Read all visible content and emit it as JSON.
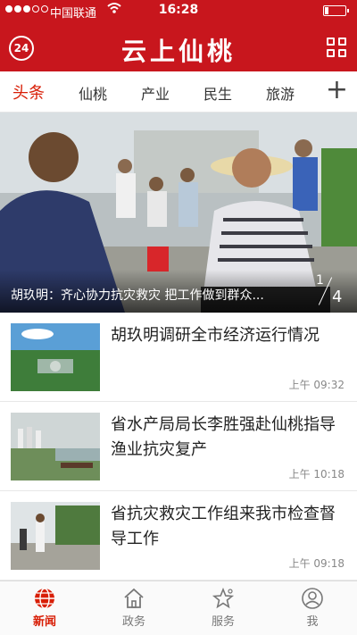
{
  "status_bar": {
    "carrier": "中国联通",
    "time": "16:28",
    "battery_level": 0.2
  },
  "header": {
    "title": "云上仙桃",
    "weather_temp": "24"
  },
  "tabs": [
    {
      "label": "头条",
      "active": true
    },
    {
      "label": "仙桃",
      "active": false
    },
    {
      "label": "产业",
      "active": false
    },
    {
      "label": "民生",
      "active": false
    },
    {
      "label": "旅游",
      "active": false
    }
  ],
  "hero": {
    "caption": "胡玖明：齐心协力抗灾救灾 把工作做到群众...",
    "current_page": "1",
    "total_pages": "4"
  },
  "news": [
    {
      "title": "胡玖明调研全市经济运行情况",
      "time": "上午 09:32"
    },
    {
      "title": "省水产局局长李胜强赴仙桃指导渔业抗灾复产",
      "time": "上午 10:18"
    },
    {
      "title": "省抗灾救灾工作组来我市检查督导工作",
      "time": "上午 09:18"
    }
  ],
  "bottom_nav": [
    {
      "label": "新闻",
      "icon": "globe-icon",
      "active": true
    },
    {
      "label": "政务",
      "icon": "home-icon",
      "active": false
    },
    {
      "label": "服务",
      "icon": "star-icon",
      "active": false
    },
    {
      "label": "我",
      "icon": "user-icon",
      "active": false
    }
  ],
  "colors": {
    "brand_red": "#c8161d",
    "active_red": "#d81e06"
  }
}
